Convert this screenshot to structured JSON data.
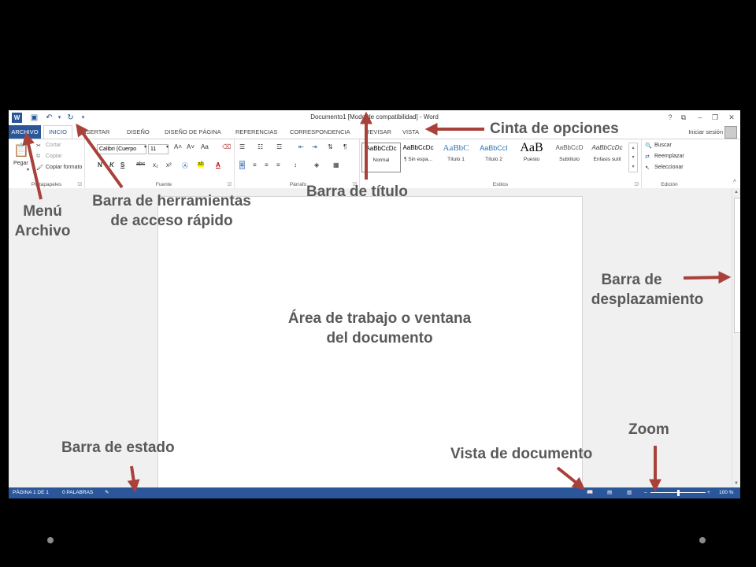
{
  "window": {
    "title": "Documento1 [Modo de compatibilidad] - Word",
    "controls": [
      "?",
      "⧉",
      "–",
      "❐",
      "✕"
    ]
  },
  "tabs": [
    "ARCHIVO",
    "INICIO",
    "INSERTAR",
    "DISEÑO",
    "DISEÑO DE PÁGINA",
    "REFERENCIAS",
    "CORRESPONDENCIA",
    "REVISAR",
    "VISTA"
  ],
  "signin": "Iniciar sesión",
  "ribbon": {
    "clipboard": {
      "label": "Portapapeles",
      "paste": "Pegar",
      "cut": "Cortar",
      "copy": "Copiar",
      "format_painter": "Copiar formato"
    },
    "font": {
      "label": "Fuente",
      "font_name": "Calibri (Cuerpo",
      "font_size": "11",
      "bold": "N",
      "italic": "K",
      "underline": "S",
      "strike": "abc",
      "subscript": "x₂",
      "superscript": "x²",
      "grow": "A˄",
      "shrink": "A˅",
      "case": "Aa",
      "highlight": "ab",
      "font_color": "A"
    },
    "paragraph": {
      "label": "Párrafo",
      "pilcrow": "¶"
    },
    "styles": {
      "label": "Estilos",
      "items": [
        {
          "sample": "AaBbCcDc",
          "name": "Normal"
        },
        {
          "sample": "AaBbCcDc",
          "name": "¶ Sin espa..."
        },
        {
          "sample": "AaBbC",
          "name": "Título 1"
        },
        {
          "sample": "AaBbCcI",
          "name": "Título 2"
        },
        {
          "sample": "AaB",
          "name": "Puesto"
        },
        {
          "sample": "AaBbCcD",
          "name": "Subtítulo"
        },
        {
          "sample": "AaBbCcDc",
          "name": "Énfasis sutil"
        }
      ]
    },
    "editing": {
      "label": "Edición",
      "find": "Buscar",
      "replace": "Reemplazar",
      "select": "Seleccionar"
    }
  },
  "statusbar": {
    "page": "PÁGINA 1 DE 1",
    "words": "0 PALABRAS",
    "zoom": "100 %",
    "zoom_level_percent": 100
  },
  "annotations": {
    "ribbon": "Cinta de opciones",
    "titlebar": "Barra de título",
    "qat_line1": "Barra de herramientas",
    "qat_line2": "de acceso rápido",
    "file_line1": "Menú",
    "file_line2": "Archivo",
    "scroll_line1": "Barra de",
    "scroll_line2": "desplazamiento",
    "workarea_line1": "Área de trabajo o ventana",
    "workarea_line2": "del documento",
    "status": "Barra de estado",
    "views": "Vista de documento",
    "zoom": "Zoom"
  },
  "colors": {
    "accent": "#2b579a",
    "arrow": "#a9413b",
    "annotation_text": "#595959",
    "background": "#000000"
  }
}
